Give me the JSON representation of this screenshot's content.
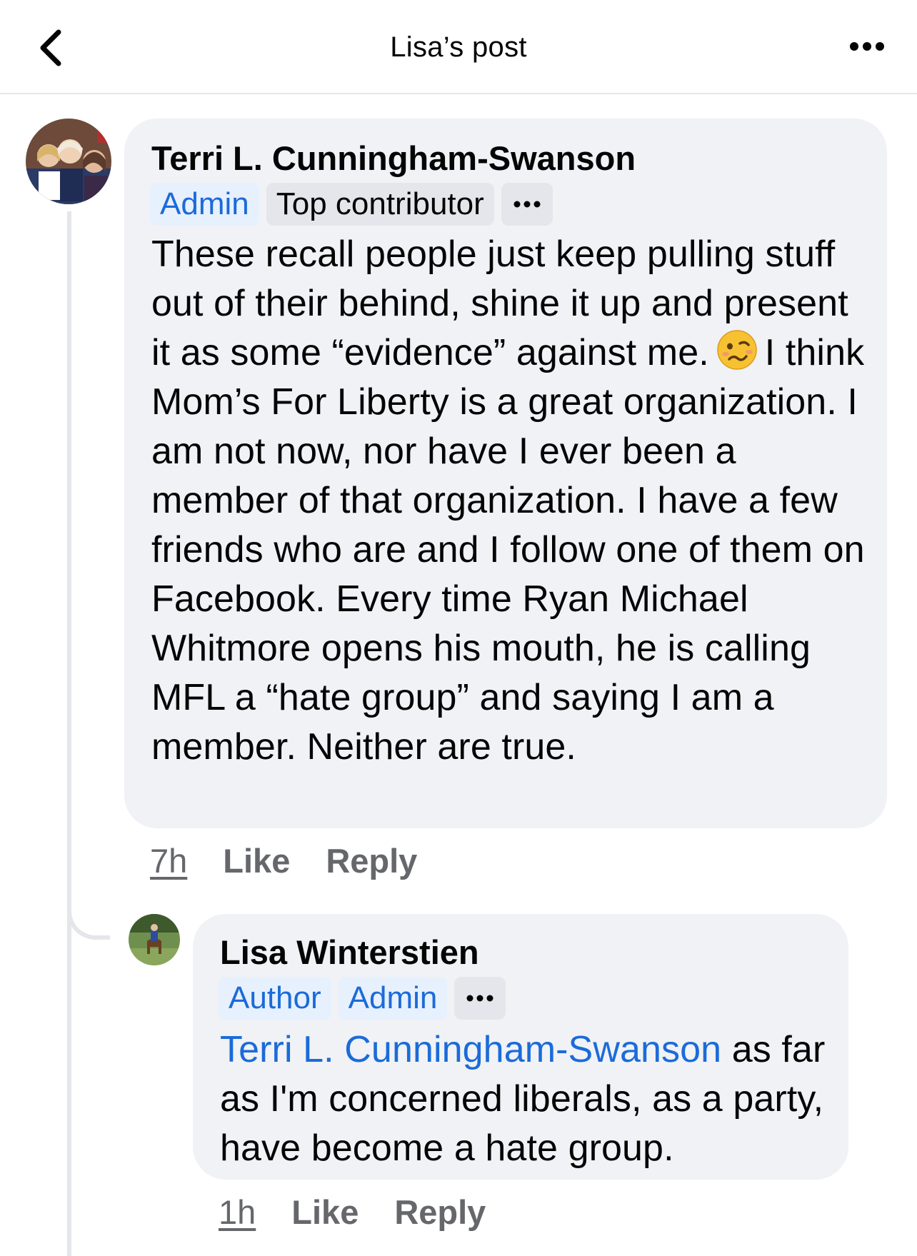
{
  "header": {
    "title": "Lisa’s post"
  },
  "comments": [
    {
      "author": "Terri L. Cunningham-Swanson",
      "badges": [
        "Admin",
        "Top contributor"
      ],
      "text_before_emoji": "These recall people just keep pulling stuff out of their behind, shine it up and present it as some “evidence” against me.",
      "emoji": "woozy-face",
      "text_after_emoji": "I think Mom’s For Liberty is a great organization. I am not now, nor have I ever been a member of that organization. I have a few friends who are and I follow one of them on Facebook. Every time Ryan Michael Whitmore opens his mouth, he is calling MFL a “hate group” and saying I am a member. Neither are true.",
      "time": "7h",
      "like": "Like",
      "reply": "Reply"
    },
    {
      "author": "Lisa Winterstien",
      "badges": [
        "Author",
        "Admin"
      ],
      "mention": "Terri L. Cunningham-Swanson",
      "text": " as far as I'm concerned liberals, as a party, have become a hate group.",
      "time": "1h",
      "like": "Like",
      "reply": "Reply"
    }
  ],
  "colors": {
    "link_blue": "#1b6bd9",
    "bubble_gray": "#f0f2f5",
    "secondary_text": "#65676b"
  },
  "icons": [
    "back-chevron-icon",
    "more-dots-icon",
    "woozy-face-emoji"
  ]
}
